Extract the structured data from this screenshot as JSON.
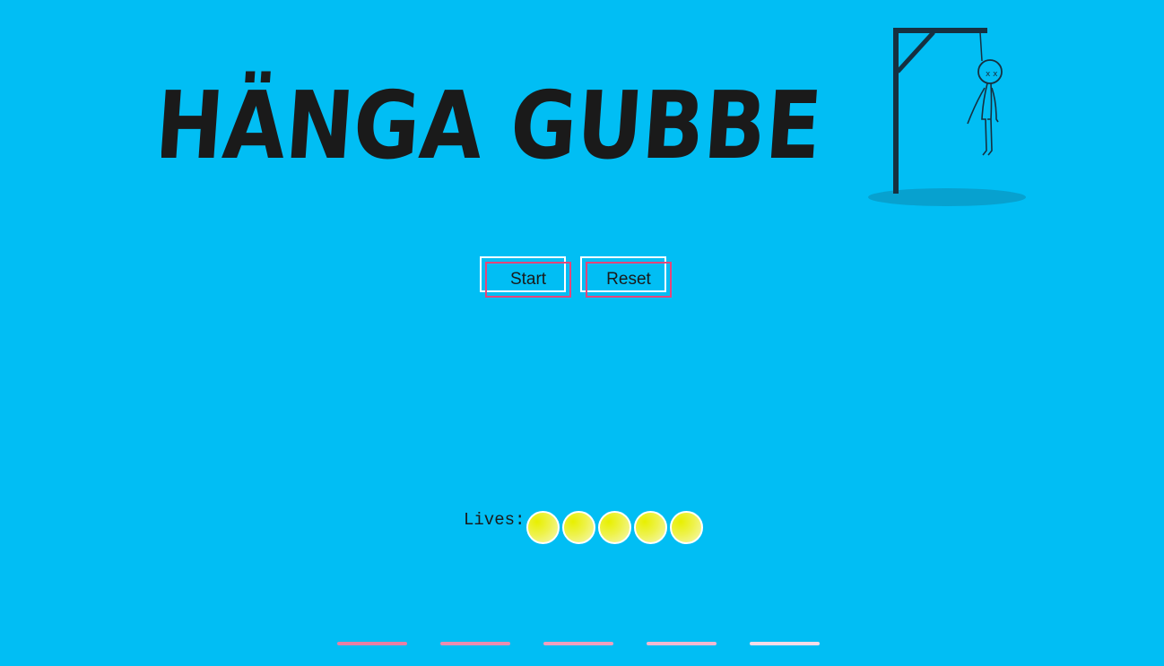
{
  "game": {
    "title": "HÄNGA GUBBE"
  },
  "controls": {
    "start_label": "Start",
    "reset_label": "Reset"
  },
  "lives": {
    "label": "Lives:",
    "count": 5
  },
  "word": {
    "letter_slots": 5,
    "slot_colors": [
      "#e77fa4",
      "#ea8cb0",
      "#ee9fbe",
      "#f2b8d1",
      "#f6dbe8"
    ]
  },
  "colors": {
    "background": "#01bef4",
    "accent_pink": "#e8457a",
    "life_fill": "#eef24a",
    "ink": "#1a1a1a"
  }
}
